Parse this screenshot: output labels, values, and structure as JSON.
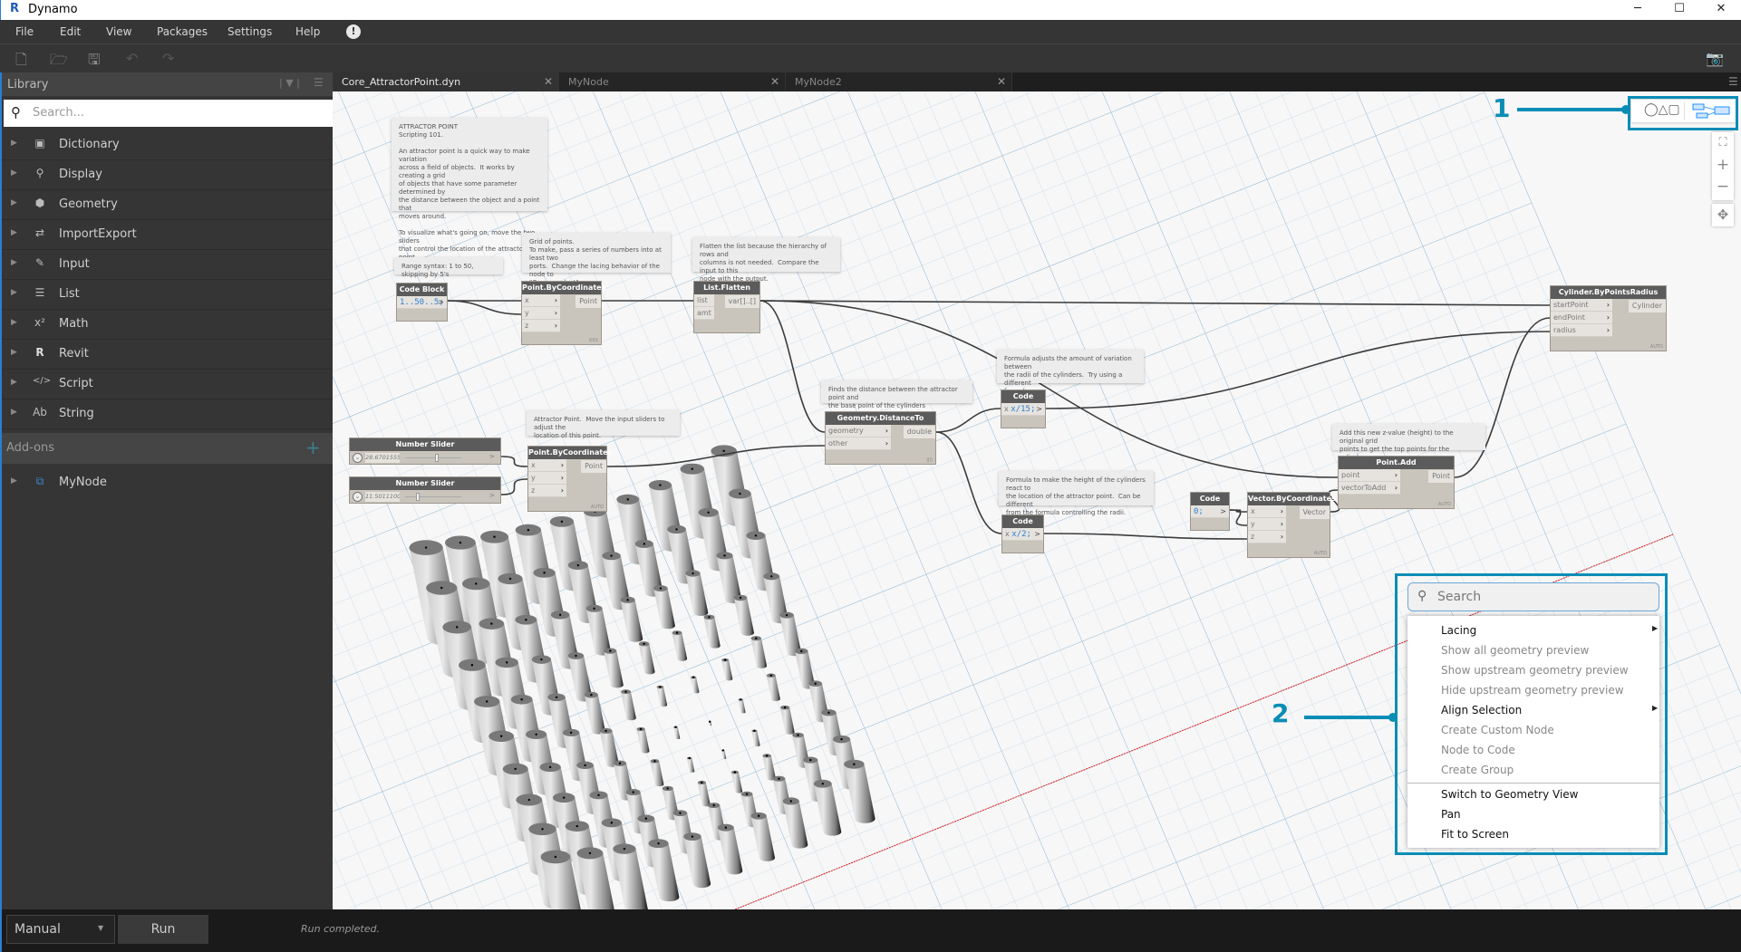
{
  "window": {
    "title": "Dynamo",
    "logo": "R",
    "minimize": "─",
    "maximize": "☐",
    "close": "✕"
  },
  "menu": [
    "File",
    "Edit",
    "View",
    "Packages",
    "Settings",
    "Help"
  ],
  "menu_alert_icon": "!",
  "toolbar": {
    "icons": [
      "new-file-icon",
      "open-folder-icon",
      "save-icon",
      "undo-icon",
      "redo-icon",
      "camera-icon"
    ]
  },
  "library": {
    "title": "Library",
    "search_placeholder": "Search...",
    "items": [
      {
        "label": "Dictionary",
        "icon": "▣"
      },
      {
        "label": "Display",
        "icon": "⚲"
      },
      {
        "label": "Geometry",
        "icon": "⬢"
      },
      {
        "label": "ImportExport",
        "icon": "⇄"
      },
      {
        "label": "Input",
        "icon": "✎"
      },
      {
        "label": "List",
        "icon": "☰"
      },
      {
        "label": "Math",
        "icon": "x²"
      },
      {
        "label": "Revit",
        "icon": "R"
      },
      {
        "label": "Script",
        "icon": "</>"
      },
      {
        "label": "String",
        "icon": "Ab"
      }
    ],
    "addons_label": "Add-ons",
    "addons_plus": "+",
    "addon_items": [
      {
        "label": "MyNode",
        "icon": "⧉"
      }
    ]
  },
  "tabs": [
    {
      "label": "Core_AttractorPoint.dyn",
      "active": true
    },
    {
      "label": "MyNode"
    },
    {
      "label": "MyNode2"
    }
  ],
  "notes": {
    "attractor": "ATTRACTOR POINT\nScripting 101.\n\nAn attractor point is a quick way to make variation\nacross a field of objects.  It works by creating a grid\nof objects that have some parameter determined by\nthe distance between the object and a point that\nmoves around.\n\nTo visualize what's going on, move the two sliders\nthat control the location of the attractor point.",
    "range": "Range syntax: 1 to 50, skipping by 5's",
    "grid": "Grid of points.\nTo make, pass a series of numbers into at least two\nports.  Change the lacing behavior of the node to\n\"Cross product\"",
    "flatten": "Flatten the list because the hierarchy of rows and\ncolumns is not needed.  Compare the input to this\nnode with the output.",
    "distance": "Finds the distance between the attractor point and\nthe base point of the cylinders",
    "attractor_pt": "Attractor Point.  Move the input sliders to adjust the\nlocation of this point.",
    "radius": "Formula adjusts the amount of variation between\nthe radii of the cylinders.  Try using a different\nformula.",
    "height": "Formula to make the height of the cylinders react to\nthe location of the attractor point.  Can be different\nfrom the formula controlling the radii.",
    "add": "Add this new z-value (height) to the original grid\npoints to get the top points for the cylinders."
  },
  "nodes": {
    "cb_range": {
      "title": "Code Block",
      "code": "1..50..5;",
      "out": ">"
    },
    "pbc1": {
      "title": "Point.ByCoordinates",
      "inputs": [
        "x",
        "y",
        "z"
      ],
      "output": "Point",
      "lacing": "XXX"
    },
    "flatten": {
      "title": "List.Flatten",
      "inputs": [
        "list",
        "amt"
      ],
      "output": "var[]..[]"
    },
    "slider1": {
      "title": "Number Slider",
      "value": "28.67015559809",
      "fraction": 0.57
    },
    "slider2": {
      "title": "Number Slider",
      "value": "11.50111001162",
      "fraction": 0.23
    },
    "pbc2": {
      "title": "Point.ByCoordinates",
      "inputs": [
        "x",
        "y",
        "z"
      ],
      "output": "Point",
      "lacing": "AUTO"
    },
    "distance": {
      "title": "Geometry.DistanceTo",
      "inputs": [
        "geometry",
        "other"
      ],
      "output": "double",
      "lacing": "|||\\"
    },
    "cb_radius": {
      "title": "Code Block",
      "input": "x",
      "code": "x/15;",
      "out": ">"
    },
    "cb_height": {
      "title": "Code Block",
      "input": "x",
      "code": "x/2;",
      "out": ">"
    },
    "cb_zero": {
      "title": "Code Block",
      "code": "0;",
      "out": ">"
    },
    "vbc": {
      "title": "Vector.ByCoordinates",
      "inputs": [
        "x",
        "y",
        "z"
      ],
      "output": "Vector",
      "lacing": "AUTO"
    },
    "padd": {
      "title": "Point.Add",
      "inputs": [
        "point",
        "vectorToAdd"
      ],
      "output": "Point",
      "lacing": "AUTO"
    },
    "cyl": {
      "title": "Cylinder.ByPointsRadius",
      "inputs": [
        "startPoint",
        "endPoint",
        "radius"
      ],
      "output": "Cylinder",
      "lacing": "AUTO"
    }
  },
  "callouts": {
    "one": "1",
    "two": "2"
  },
  "view_toggle": {
    "icons": [
      "geometry-view-icon",
      "graph-view-icon"
    ],
    "active": "graph"
  },
  "nav": {
    "fit": "⛶",
    "zoom_in": "+",
    "zoom_out": "−",
    "pan": "✥"
  },
  "context_menu": {
    "search_placeholder": "Search",
    "items": [
      {
        "label": "Lacing",
        "enabled": true,
        "submenu": true
      },
      {
        "label": "Show all geometry preview",
        "enabled": false
      },
      {
        "label": "Show upstream geometry preview",
        "enabled": false
      },
      {
        "label": "Hide upstream geometry preview",
        "enabled": false
      },
      {
        "label": "Align Selection",
        "enabled": true,
        "submenu": true
      },
      {
        "label": "Create Custom Node",
        "enabled": false
      },
      {
        "label": "Node to Code",
        "enabled": false
      },
      {
        "label": "Create Group",
        "enabled": false
      }
    ],
    "items2": [
      {
        "label": "Switch to Geometry View"
      },
      {
        "label": "Pan"
      },
      {
        "label": "Fit to Screen"
      }
    ]
  },
  "bottom": {
    "run_mode": "Manual",
    "run_label": "Run",
    "status": "Run completed."
  },
  "colors": {
    "accent": "#0a8db5",
    "node_header": "#5b5b5b",
    "wire": "#3c3c3c",
    "grid_axis": "#e02020"
  }
}
